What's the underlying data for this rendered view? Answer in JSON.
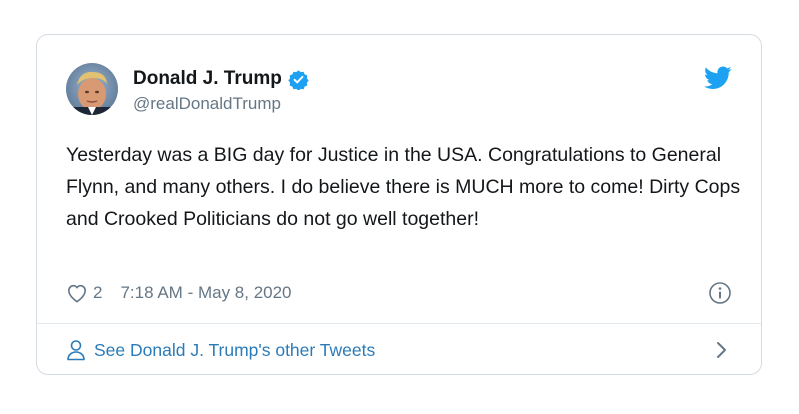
{
  "tweet": {
    "author_name": "Donald J. Trump",
    "handle": "@realDonaldTrump",
    "text": "Yesterday was a BIG day for Justice in the USA. Congratulations to General Flynn, and many others. I do believe there is MUCH more to come! Dirty Cops and Crooked Politicians do not go well together!",
    "like_count": "2",
    "timestamp": "7:18 AM - May 8, 2020",
    "see_more_label": "See Donald J. Trump's other Tweets"
  },
  "icons": {
    "verified": "verified-badge-icon",
    "brand": "twitter-bird-icon",
    "like": "heart-icon",
    "info": "info-icon",
    "profile": "person-icon",
    "chevron": "chevron-right-icon"
  },
  "colors": {
    "accent_blue": "#1da1f2",
    "link_blue": "#2b7bb9",
    "text_primary": "#14171a",
    "text_secondary": "#657786",
    "border": "#d4dbe1"
  }
}
